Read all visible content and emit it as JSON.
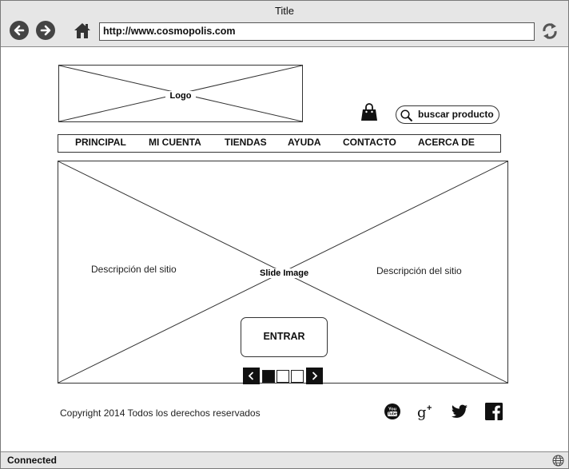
{
  "window": {
    "title": "Title"
  },
  "address_bar": {
    "url": "http://www.cosmopolis.com"
  },
  "header": {
    "logo_label": "Logo",
    "search_placeholder": "buscar producto"
  },
  "menu": {
    "items": [
      {
        "label": "PRINCIPAL"
      },
      {
        "label": "MI CUENTA"
      },
      {
        "label": "TIENDAS"
      },
      {
        "label": "AYUDA"
      },
      {
        "label": "CONTACTO"
      },
      {
        "label": "ACERCA DE"
      }
    ]
  },
  "slide": {
    "image_label": "Slide Image",
    "description_left": "Descripción del sitio",
    "description_right": "Descripción del sitio",
    "enter_label": "ENTRAR",
    "pager": {
      "pages": 3,
      "active_page": 1
    }
  },
  "footer": {
    "copyright": "Copyright 2014 Todos los derechos reservados",
    "social_icons": [
      "youtube-icon",
      "google-plus-icon",
      "twitter-icon",
      "facebook-icon"
    ]
  },
  "status": {
    "text": "Connected"
  }
}
